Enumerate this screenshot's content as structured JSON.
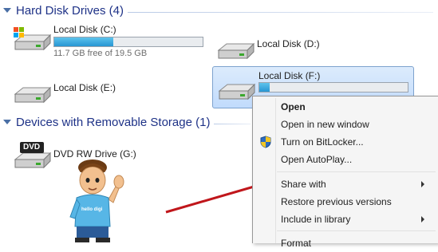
{
  "groups": {
    "hdd": {
      "title": "Hard Disk Drives (4)"
    },
    "removable": {
      "title": "Devices with Removable Storage (1)"
    }
  },
  "drives": {
    "c": {
      "name": "Local Disk (C:)",
      "free_text": "11.7 GB free of 19.5 GB",
      "used_fraction": 0.4
    },
    "d": {
      "name": "Local Disk (D:)"
    },
    "e": {
      "name": "Local Disk (E:)"
    },
    "f": {
      "name": "Local Disk (F:)",
      "used_fraction": 0.07
    },
    "g": {
      "name": "DVD RW Drive (G:)",
      "icon_label": "DVD"
    }
  },
  "mascot": {
    "shirt_text": "hello digi"
  },
  "context_menu": {
    "items": [
      {
        "label": "Open",
        "bold": true
      },
      {
        "label": "Open in new window"
      },
      {
        "label": "Turn on BitLocker...",
        "icon": "uac-shield-icon"
      },
      {
        "label": "Open AutoPlay..."
      },
      {
        "label": "Share with",
        "submenu": true
      },
      {
        "label": "Restore previous versions"
      },
      {
        "label": "Include in library",
        "submenu": true
      },
      {
        "label": "Format"
      }
    ]
  },
  "colors": {
    "header_text": "#1e3287",
    "progress_fill": "#2796d3",
    "selection": "#c1dbfc",
    "arrow": "#c0161b"
  }
}
